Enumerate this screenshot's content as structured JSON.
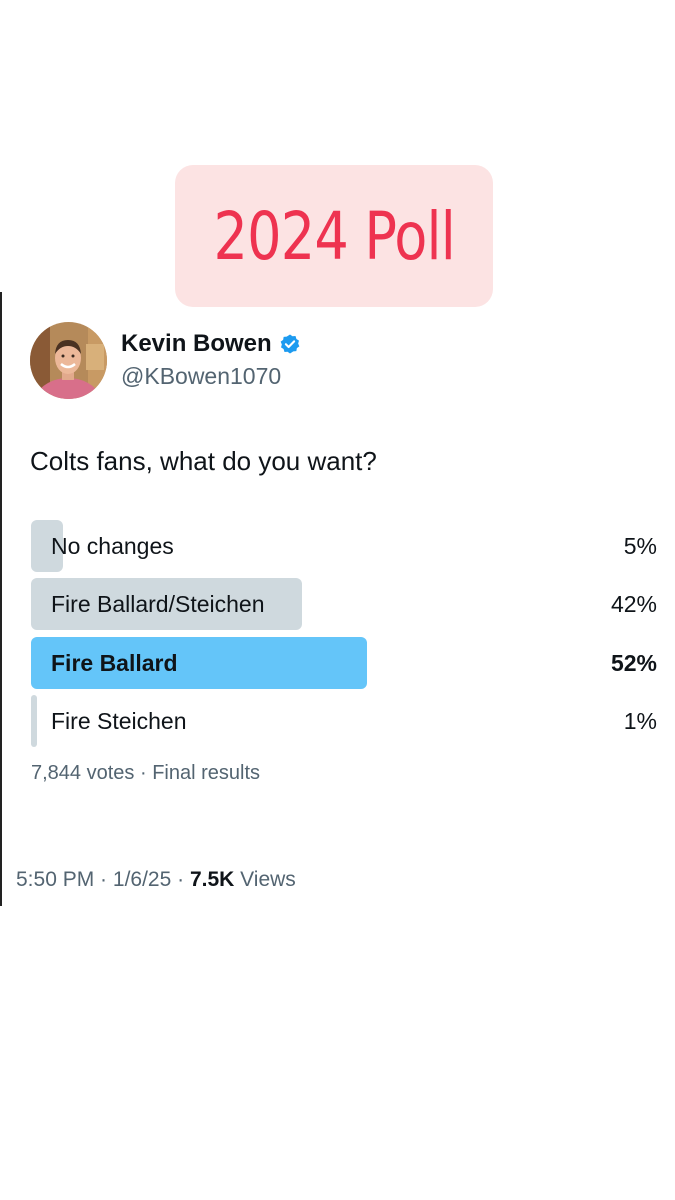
{
  "sticker": {
    "text": "2024 Poll"
  },
  "tweet": {
    "author": {
      "name": "Kevin Bowen",
      "handle": "@KBowen1070",
      "verified": true,
      "verified_color": "#1d9bf0"
    },
    "text": "Colts fans, what do you want?",
    "poll": {
      "options": [
        {
          "label": "No changes",
          "percent_text": "5%",
          "share": 0.05,
          "winner": false
        },
        {
          "label": "Fire Ballard/Steichen",
          "percent_text": "42%",
          "share": 0.42,
          "winner": false
        },
        {
          "label": "Fire Ballard",
          "percent_text": "52%",
          "share": 0.52,
          "winner": true
        },
        {
          "label": "Fire Steichen",
          "percent_text": "1%",
          "share": 0.01,
          "winner": false
        }
      ],
      "votes": "7,844 votes",
      "separator": " · ",
      "status": "Final results"
    },
    "time": "5:50 PM",
    "date": "1/6/25",
    "views_count": "7.5K",
    "views_label": "Views"
  },
  "colors": {
    "sticker_bg": "#fce3e3",
    "sticker_text": "#ee3350",
    "poll_bar": "#cfd9de",
    "poll_winner": "#64c5f9"
  }
}
